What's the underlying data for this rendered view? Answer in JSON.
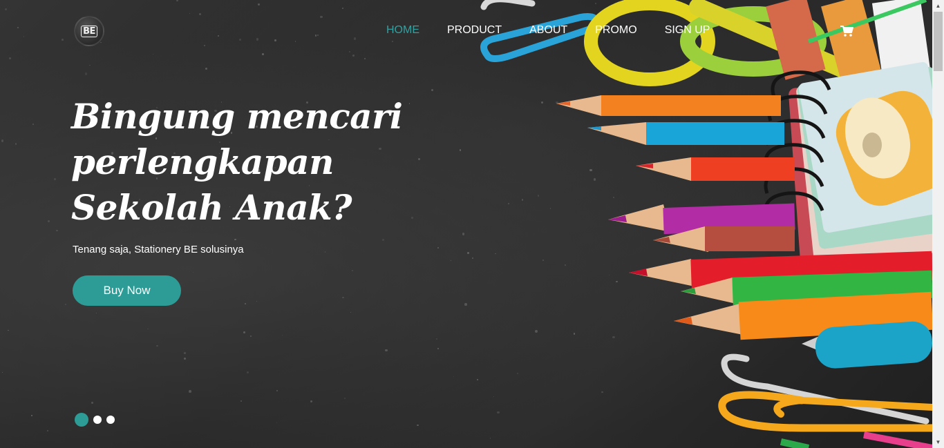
{
  "brand": {
    "logo_text": "BE"
  },
  "nav": {
    "items": [
      {
        "label": "HOME",
        "active": true
      },
      {
        "label": "PRODUCT",
        "active": false
      },
      {
        "label": "ABOUT",
        "active": false
      },
      {
        "label": "PROMO",
        "active": false
      },
      {
        "label": "SIGN UP",
        "active": false
      }
    ],
    "cart_icon": "cart-icon"
  },
  "hero": {
    "headline": "Bingung mencari perlengkapan Sekolah Anak?",
    "subtitle": "Tenang saja, Stationery BE solusinya",
    "cta_label": "Buy Now",
    "carousel": {
      "slides": 3,
      "active_slide": 1
    }
  },
  "colors": {
    "accent": "#2e9c96",
    "nav_active": "#34a0a0",
    "background": "#2b2b2b",
    "text": "#ffffff"
  }
}
